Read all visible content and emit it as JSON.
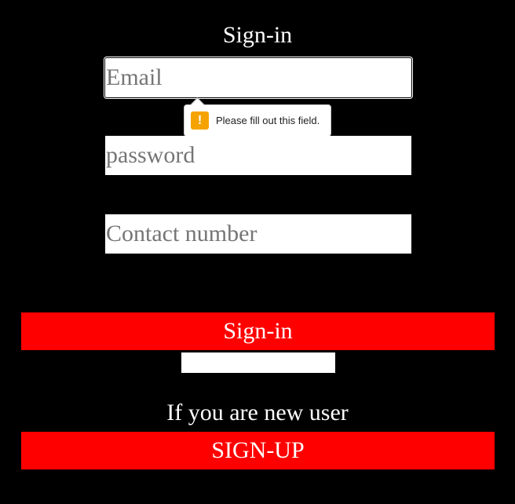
{
  "form": {
    "title": "Sign-in",
    "email_placeholder": "Email",
    "password_placeholder": "password",
    "contact_placeholder": "Contact number",
    "signin_label": "Sign-in",
    "new_user_text": "If you are new user",
    "signup_label": "SIGN-UP"
  },
  "validation": {
    "message": "Please fill out this field.",
    "icon": "warning-icon",
    "icon_glyph": "!",
    "icon_color": "#f5a300"
  },
  "colors": {
    "background": "#000000",
    "button": "#ff0000",
    "text": "#ffffff"
  }
}
